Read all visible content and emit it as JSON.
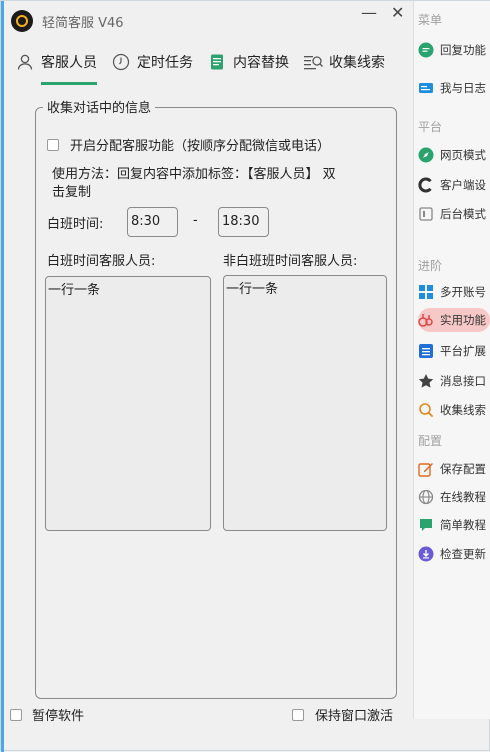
{
  "app": {
    "title": "轻简客服  V46"
  },
  "window_controls": {
    "minimize": "—",
    "close": "✕"
  },
  "tabs": [
    {
      "label": "客服人员",
      "icon": "user-icon",
      "active": true
    },
    {
      "label": "定时任务",
      "icon": "clock-icon",
      "active": false
    },
    {
      "label": "内容替换",
      "icon": "document-icon",
      "active": false
    },
    {
      "label": "收集线索",
      "icon": "search-list-icon",
      "active": false
    }
  ],
  "sidebar": {
    "sections": {
      "menu": "菜单",
      "platform": "平台",
      "advanced": "进阶",
      "config": "配置"
    },
    "items": [
      {
        "label": "回复功能",
        "icon": "chat-icon",
        "color": "#2aa36e"
      },
      {
        "label": "我与日志",
        "icon": "log-icon",
        "color": "#1f8de0"
      },
      {
        "label": "网页模式",
        "icon": "compass-icon",
        "color": "#2aa36e"
      },
      {
        "label": "客户端设",
        "icon": "c-icon",
        "color": "#333333"
      },
      {
        "label": "后台模式",
        "icon": "window-icon",
        "color": "#888888"
      },
      {
        "label": "多开账号",
        "icon": "grid-icon",
        "color": "#1f8de0"
      },
      {
        "label": "实用功能",
        "icon": "tools-icon",
        "color": "#e04848",
        "active": true
      },
      {
        "label": "平台扩展",
        "icon": "list-icon",
        "color": "#1f6fd6"
      },
      {
        "label": "消息接口",
        "icon": "star-icon",
        "color": "#444444"
      },
      {
        "label": "收集线索",
        "icon": "magnify-icon",
        "color": "#e08a1f"
      },
      {
        "label": "保存配置",
        "icon": "edit-icon",
        "color": "#e06a1f"
      },
      {
        "label": "在线教程",
        "icon": "globe-icon",
        "color": "#888888"
      },
      {
        "label": "简单教程",
        "icon": "message-icon",
        "color": "#2aa36e"
      },
      {
        "label": "检查更新",
        "icon": "update-icon",
        "color": "#6a5ad6"
      }
    ]
  },
  "group": {
    "legend": "收集对话中的信息",
    "enable_label": "开启分配客服功能（按顺序分配微信或电话）",
    "usage_line1": "使用方法：回复内容中添加标签：【客服人员】 双",
    "usage_line2": "击复制",
    "day_shift_label": "白班时间:",
    "start_time": "8:30",
    "dash": "-",
    "end_time": "18:30",
    "day_staff_label": "白班时间客服人员:",
    "night_staff_label": "非白班班时间客服人员:",
    "day_staff_placeholder": "一行一条",
    "night_staff_placeholder": "一行一条"
  },
  "footer": {
    "pause_label": "暂停软件",
    "keep_active_label": "保持窗口激活"
  }
}
